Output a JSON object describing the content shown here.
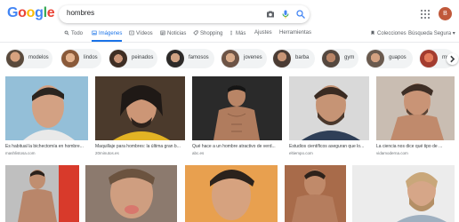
{
  "logo": {
    "letters": [
      "G",
      "o",
      "o",
      "g",
      "l",
      "e"
    ],
    "colors": [
      "#4285F4",
      "#EA4335",
      "#FBBC05",
      "#4285F4",
      "#34A853",
      "#EA4335"
    ]
  },
  "search": {
    "query": "hombres"
  },
  "user": {
    "initial": "B"
  },
  "tabs": [
    {
      "label": "Todo",
      "icon": "search-icon"
    },
    {
      "label": "Imágenes",
      "icon": "image-icon",
      "active": true
    },
    {
      "label": "Vídeos",
      "icon": "video-icon"
    },
    {
      "label": "Noticias",
      "icon": "news-icon"
    },
    {
      "label": "Shopping",
      "icon": "tag-icon"
    },
    {
      "label": "Más",
      "icon": "more-icon"
    },
    {
      "label": "Ajustes"
    },
    {
      "label": "Herramientas"
    }
  ],
  "collections": {
    "label": "Colecciones"
  },
  "safesearch": {
    "label": "Búsqueda Segura ▾"
  },
  "chips": [
    {
      "label": "modelos"
    },
    {
      "label": "lindos"
    },
    {
      "label": "peinados"
    },
    {
      "label": "famosos"
    },
    {
      "label": "jovenes"
    },
    {
      "label": "barba"
    },
    {
      "label": "gym"
    },
    {
      "label": "guapos"
    },
    {
      "label": "mu"
    }
  ],
  "results": [
    {
      "caption": "Es habitual la bichectomía en hombre...",
      "source": "mashlistosa.com"
    },
    {
      "caption": "Maquillaje para hombres: la última gran b...",
      "source": "20minutos.es"
    },
    {
      "caption": "Qué hace a un hombre atractivo de verd...",
      "source": "abc.es"
    },
    {
      "caption": "Estudios científicos aseguran que lo...",
      "source": "eltiempo.com"
    },
    {
      "caption": "La ciencia nos dice qué tipo de ...",
      "source": "vidamoderna.com"
    },
    {
      "caption": "",
      "source": ""
    },
    {
      "caption": "",
      "source": ""
    },
    {
      "caption": "",
      "source": ""
    },
    {
      "caption": "",
      "source": ""
    },
    {
      "caption": "",
      "source": ""
    }
  ]
}
